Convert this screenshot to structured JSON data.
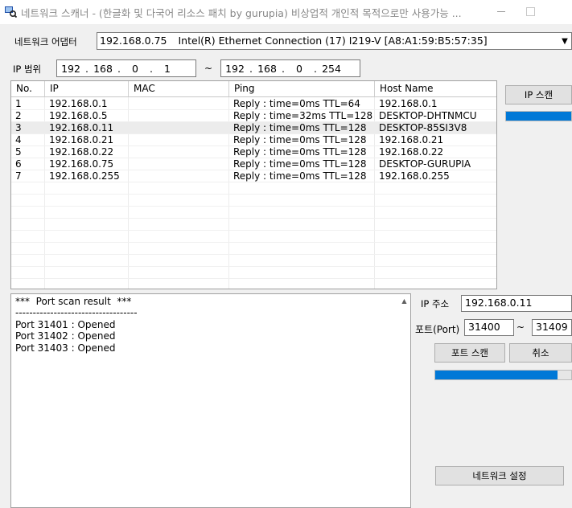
{
  "window": {
    "title": "네트워크 스캐너 - (한글화 및 다국어 리소스 패치 by gurupia)  비상업적 개인적 목적으로만 사용가능 ..."
  },
  "adapter": {
    "label": "네트워크 어댑터",
    "ip": "192.168.0.75",
    "name": "Intel(R) Ethernet Connection (17) I219-V [A8:A1:59:B5:57:35]"
  },
  "ip_range": {
    "label": "IP 범위",
    "separator": "~",
    "start": [
      "192",
      "168",
      "0",
      "1"
    ],
    "end": [
      "192",
      "168",
      "0",
      "254"
    ]
  },
  "table": {
    "columns": [
      "No.",
      "IP",
      "MAC",
      "Ping",
      "Host Name"
    ],
    "rows": [
      {
        "no": "1",
        "ip": "192.168.0.1",
        "mac": "",
        "ping": "Reply : time=0ms TTL=64",
        "host": "192.168.0.1"
      },
      {
        "no": "2",
        "ip": "192.168.0.5",
        "mac": "",
        "ping": "Reply : time=32ms TTL=128",
        "host": "DESKTOP-DHTNMCU"
      },
      {
        "no": "3",
        "ip": "192.168.0.11",
        "mac": "",
        "ping": "Reply : time=0ms TTL=128",
        "host": "DESKTOP-85SI3V8"
      },
      {
        "no": "4",
        "ip": "192.168.0.21",
        "mac": "",
        "ping": "Reply : time=0ms TTL=128",
        "host": "192.168.0.21"
      },
      {
        "no": "5",
        "ip": "192.168.0.22",
        "mac": "",
        "ping": "Reply : time=0ms TTL=128",
        "host": "192.168.0.22"
      },
      {
        "no": "6",
        "ip": "192.168.0.75",
        "mac": "",
        "ping": "Reply : time=0ms TTL=128",
        "host": "DESKTOP-GURUPIA"
      },
      {
        "no": "7",
        "ip": "192.168.0.255",
        "mac": "",
        "ping": "Reply : time=0ms TTL=128",
        "host": "192.168.0.255"
      }
    ],
    "selected_row": 2
  },
  "ip_scan": {
    "button_label": "IP 스캔",
    "progress": 1.0
  },
  "output": {
    "lines": [
      "***  Port scan result  ***",
      "-----------------------------------",
      "Port 31401 : Opened",
      "Port 31402 : Opened",
      "Port 31403 : Opened"
    ]
  },
  "port_scan": {
    "ip_label": "IP 주소",
    "ip_value": "192.168.0.11",
    "port_label": "포트(Port)",
    "port_from": "31400",
    "port_separator": "~",
    "port_to": "31409",
    "scan_button": "포트 스캔",
    "cancel_button": "취소",
    "progress": 1.0
  },
  "network_settings_button": "네트워크 설정",
  "colors": {
    "progress": "#0078d7",
    "background": "#f0f0f0"
  }
}
